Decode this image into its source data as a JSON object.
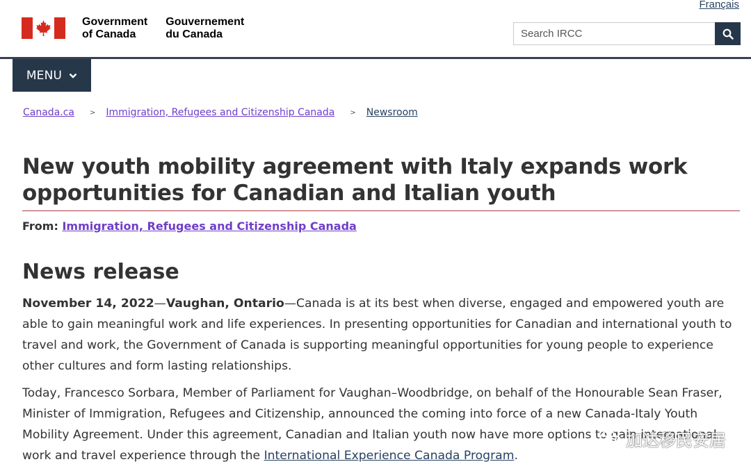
{
  "header": {
    "language_link": "Français",
    "gov_en_line1": "Government",
    "gov_en_line2": "of Canada",
    "gov_fr_line1": "Gouvernement",
    "gov_fr_line2": "du Canada",
    "search_placeholder": "Search IRCC",
    "search_icon": "magnifier-icon",
    "flag_color": "#d52b1e"
  },
  "nav": {
    "menu_label": "MENU"
  },
  "breadcrumb": [
    "Canada.ca",
    "Immigration, Refugees and Citizenship Canada",
    "Newsroom"
  ],
  "article": {
    "title": "New youth mobility agreement with Italy expands work opportunities for Canadian and Italian youth",
    "from_label": "From:",
    "from_link": "Immigration, Refugees and Citizenship Canada",
    "section_heading": "News release",
    "dateline_date": "November 14, 2022",
    "dateline_place": "Vaughan, Ontario",
    "p1_text": "Canada is at its best when diverse, engaged and empowered youth are able to gain meaningful work and life experiences. In presenting opportunities for Canadian and international youth to travel and work, the Government of Canada is supporting meaningful opportunities for young people to experience other cultures and form lasting relationships.",
    "p2_text": "Today, Francesco Sorbara, Member of Parliament for Vaughan–Woodbridge, on behalf of the Honourable Sean Fraser, Minister of Immigration, Refugees and Citizenship, announced the coming into force of a new Canada-Italy Youth Mobility Agreement. Under this agreement, Canadian and Italian youth now have more options to gain international work and travel experience through the ",
    "p2_link": "International Experience Canada Program",
    "p2_end": "."
  },
  "watermark": {
    "text": "加达移民安居",
    "icon": "wechat-icon"
  }
}
